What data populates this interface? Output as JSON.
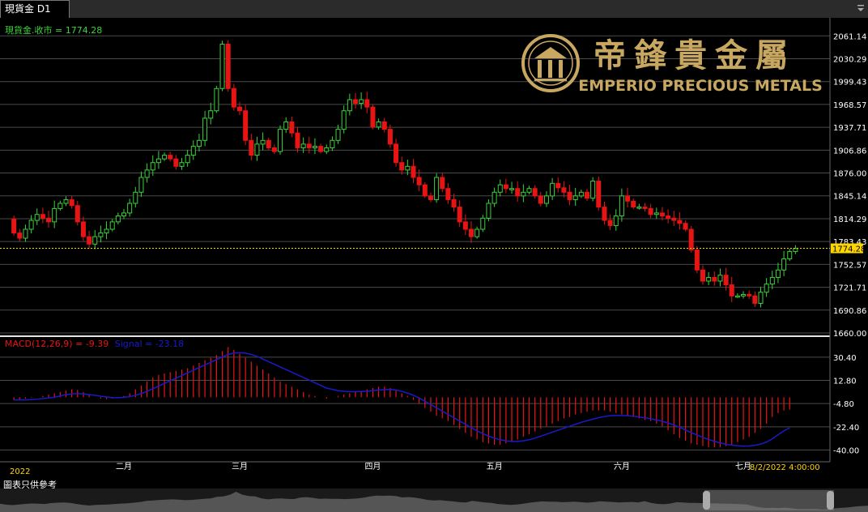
{
  "window": {
    "tab_title": "現貨金 D1"
  },
  "price_label": "現貨金.收市 = 1774.28",
  "macd": {
    "label": "MACD(12,26,9) = -9.39",
    "signal_label": "Signal = -23.18"
  },
  "logo": {
    "cn": "帝鋒貴金屬",
    "en": "EMPERIO PRECIOUS METALS"
  },
  "footer": {
    "year": "2022",
    "cursor_time": "8/2/2022 4:00:00",
    "disclaimer": "圖表只供參考"
  },
  "colors": {
    "up": "#39d339",
    "down": "#e81414",
    "signal": "#1a1acc",
    "current": "#ffd700",
    "logo_gold": "#c8a860"
  },
  "chart_data": {
    "type": "candlestick",
    "symbol": "現貨金",
    "timeframe": "D1",
    "last_close": 1774.28,
    "price_axis": {
      "ticks": [
        "2061.14",
        "2030.29",
        "1999.43",
        "1968.57",
        "1937.71",
        "1906.86",
        "1876.00",
        "1845.14",
        "1814.29",
        "1783.43",
        "1752.57",
        "1721.71",
        "1690.86",
        "1660.00"
      ],
      "range": [
        1660.0,
        2068.0
      ]
    },
    "macd_axis": {
      "ticks": [
        "30.40",
        "12.80",
        "-4.80",
        "-22.40",
        "-40.00"
      ],
      "range": [
        -44,
        42
      ]
    },
    "month_labels": [
      {
        "text": "二月",
        "bar": 20
      },
      {
        "text": "三月",
        "bar": 40
      },
      {
        "text": "四月",
        "bar": 63
      },
      {
        "text": "五月",
        "bar": 84
      },
      {
        "text": "六月",
        "bar": 106
      },
      {
        "text": "七月",
        "bar": 127
      }
    ],
    "close_path": [
      1814,
      1795,
      1788,
      1800,
      1812,
      1820,
      1815,
      1810,
      1828,
      1835,
      1840,
      1832,
      1810,
      1790,
      1780,
      1790,
      1795,
      1800,
      1810,
      1818,
      1822,
      1835,
      1850,
      1870,
      1880,
      1890,
      1895,
      1900,
      1895,
      1885,
      1890,
      1900,
      1912,
      1920,
      1950,
      1960,
      1990,
      2050,
      1990,
      1965,
      1960,
      1920,
      1900,
      1915,
      1920,
      1910,
      1905,
      1935,
      1945,
      1930,
      1910,
      1915,
      1910,
      1912,
      1905,
      1910,
      1920,
      1935,
      1960,
      1975,
      1970,
      1975,
      1965,
      1938,
      1945,
      1935,
      1915,
      1890,
      1880,
      1885,
      1870,
      1860,
      1845,
      1840,
      1870,
      1855,
      1840,
      1830,
      1810,
      1800,
      1790,
      1800,
      1815,
      1835,
      1850,
      1860,
      1855,
      1855,
      1845,
      1850,
      1855,
      1845,
      1835,
      1845,
      1862,
      1856,
      1850,
      1840,
      1845,
      1850,
      1842,
      1865,
      1830,
      1812,
      1805,
      1818,
      1845,
      1838,
      1830,
      1830,
      1828,
      1820,
      1822,
      1818,
      1815,
      1812,
      1808,
      1800,
      1772,
      1745,
      1730,
      1735,
      1730,
      1738,
      1725,
      1710,
      1710,
      1712,
      1710,
      1700,
      1715,
      1726,
      1735,
      1745,
      1760,
      1770,
      1774
    ],
    "macd_values": [
      -2,
      -1.5,
      -1,
      -0.5,
      0,
      1,
      2,
      3,
      4,
      5,
      6,
      5.5,
      4,
      2,
      0,
      -1,
      -1.5,
      -1,
      0,
      1,
      3,
      6,
      9,
      12,
      15,
      17,
      18,
      19,
      20,
      21,
      22,
      24,
      26,
      28,
      30,
      32,
      35,
      38,
      36,
      33,
      30,
      27,
      24,
      21,
      18,
      15,
      12,
      10,
      8,
      6,
      4,
      2,
      1,
      0,
      -1,
      0,
      1,
      2,
      3,
      4,
      5,
      6,
      7,
      8,
      8,
      7,
      5,
      3,
      1,
      -2,
      -5,
      -8,
      -11,
      -14,
      -16,
      -18,
      -21,
      -24,
      -27,
      -30,
      -32,
      -34,
      -35,
      -36,
      -36,
      -35,
      -34,
      -32,
      -30,
      -28,
      -26,
      -24,
      -22,
      -20,
      -18,
      -16,
      -15,
      -13,
      -12,
      -11,
      -10,
      -10,
      -10,
      -11,
      -12,
      -13,
      -14,
      -15,
      -16,
      -17,
      -18,
      -20,
      -22,
      -25,
      -28,
      -31,
      -33,
      -35,
      -36,
      -37,
      -38,
      -38,
      -38,
      -37,
      -36,
      -34,
      -32,
      -30,
      -27,
      -24,
      -20,
      -15,
      -12,
      -10,
      -9.39
    ],
    "signal_values": [
      -2,
      -2,
      -2,
      -1.8,
      -1.5,
      -1,
      -0.5,
      0,
      1,
      2,
      2.5,
      2.8,
      2.6,
      2,
      1.5,
      0.8,
      0.2,
      -0.2,
      -0.3,
      -0.1,
      0.5,
      1.5,
      2.8,
      4.5,
      6.5,
      8.5,
      10.5,
      12.5,
      14.5,
      16.5,
      18.5,
      20.5,
      22.5,
      24.5,
      26.5,
      28.5,
      30.5,
      32.5,
      33.5,
      33.8,
      33.5,
      32.5,
      31,
      29,
      27,
      25,
      23,
      21,
      19,
      17,
      15,
      13,
      11,
      9,
      7,
      6,
      5,
      4.5,
      4.2,
      4.2,
      4.4,
      4.6,
      5,
      5.4,
      5.8,
      6,
      5.5,
      4.5,
      3.2,
      1.5,
      -0.5,
      -3,
      -5.5,
      -8,
      -10.5,
      -13,
      -15.5,
      -18,
      -20.5,
      -23,
      -25.5,
      -27.5,
      -29.5,
      -31,
      -32.2,
      -33,
      -33.5,
      -33.5,
      -33,
      -32.2,
      -31,
      -29.5,
      -28,
      -26.5,
      -25,
      -23.5,
      -22,
      -20.5,
      -19,
      -17.8,
      -16.6,
      -15.5,
      -14.6,
      -14,
      -13.8,
      -13.8,
      -14,
      -14.4,
      -15,
      -15.6,
      -16.3,
      -17.2,
      -18.2,
      -19.5,
      -21,
      -22.8,
      -24.8,
      -26.8,
      -28.6,
      -30.4,
      -32,
      -33.4,
      -34.6,
      -35.6,
      -36.3,
      -36.8,
      -37,
      -36.9,
      -36.4,
      -35.5,
      -34,
      -31.5,
      -28.5,
      -25.5,
      -23.18
    ]
  }
}
